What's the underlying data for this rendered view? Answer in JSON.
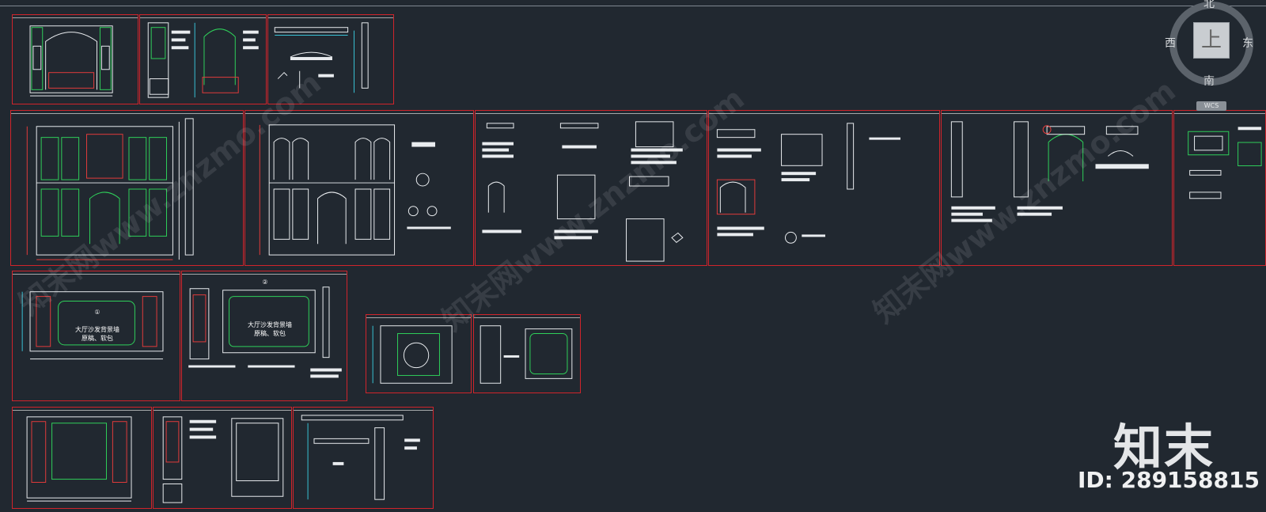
{
  "viewcube": {
    "north": "北",
    "south": "南",
    "east": "东",
    "west": "西",
    "face": "上",
    "wcs": "WCS"
  },
  "watermark": {
    "logo": "知末",
    "id": "ID: 289158815",
    "diagonal": [
      "知末网www.znzmo.com",
      "知末网www.znzmo.com",
      "知末网www.znzmo.com"
    ]
  },
  "sheets": [
    {
      "name": "sheet-1"
    },
    {
      "name": "sheet-2"
    },
    {
      "name": "sheet-3"
    },
    {
      "name": "sheet-4"
    },
    {
      "name": "sheet-5"
    },
    {
      "name": "sheet-6"
    },
    {
      "name": "sheet-7"
    },
    {
      "name": "sheet-8"
    },
    {
      "name": "sheet-9"
    },
    {
      "name": "sheet-10"
    },
    {
      "name": "sheet-11"
    },
    {
      "name": "sheet-12"
    },
    {
      "name": "sheet-13"
    },
    {
      "name": "sheet-14"
    },
    {
      "name": "sheet-15"
    },
    {
      "name": "sheet-16"
    },
    {
      "name": "sheet-17"
    }
  ],
  "drawing_labels": {
    "sofa_wall_1": "大厅沙发背景墙\n原稿、软包",
    "sofa_wall_2": "大厅沙发背景墙\n原稿、软包",
    "num_1": "①",
    "num_2": "②"
  },
  "colors": {
    "background": "#212830",
    "sheet_border": "#d0242b",
    "line_white": "#e9ecef",
    "line_green": "#2fd05a",
    "line_cyan": "#39c3d6",
    "line_red": "#e23b3b"
  }
}
